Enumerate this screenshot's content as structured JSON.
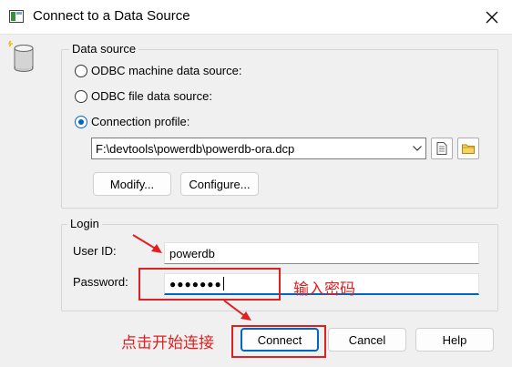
{
  "window": {
    "title": "Connect to a Data Source",
    "close_icon": "close-icon",
    "app_icon": "window-app-icon"
  },
  "data_source": {
    "legend": "Data source",
    "icon": "database-icon",
    "options": [
      {
        "label": "ODBC machine data source:",
        "checked": false
      },
      {
        "label": "ODBC file data source:",
        "checked": false
      },
      {
        "label": "Connection profile:",
        "checked": true
      }
    ],
    "profile_path": "F:\\devtools\\powerdb\\powerdb-ora.dcp",
    "modify_label": "Modify...",
    "configure_label": "Configure..."
  },
  "login": {
    "legend": "Login",
    "user_id_label": "User ID:",
    "user_id_value": "powerdb",
    "password_label": "Password:",
    "password_value": "●●●●●●●"
  },
  "buttons": {
    "connect": "Connect",
    "cancel": "Cancel",
    "help": "Help"
  },
  "annotations": {
    "password_note": "输入密码",
    "connect_note": "点击开始连接",
    "color": "#e02020"
  },
  "colors": {
    "accent": "#0067c0",
    "background": "#f0f0f0"
  }
}
